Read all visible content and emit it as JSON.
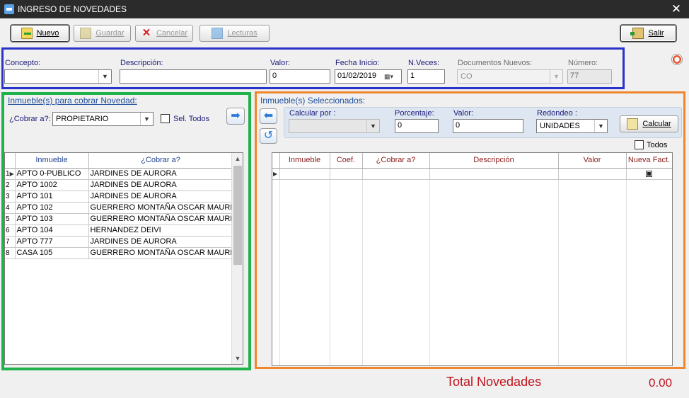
{
  "window": {
    "title": "INGRESO DE NOVEDADES",
    "close_icon": "close-icon"
  },
  "toolbar": {
    "nuevo": "Nuevo",
    "guardar": "Guardar",
    "cancelar": "Cancelar",
    "lecturas": "Lecturas",
    "salir": "Salir"
  },
  "header": {
    "concepto_label": "Concepto:",
    "concepto_value": "",
    "descripcion_label": "Descripción:",
    "descripcion_value": "",
    "valor_label": "Valor:",
    "valor_value": "0",
    "fecha_label": "Fecha Inicio:",
    "fecha_value": "01/02/2019",
    "nveces_label": "N.Veces:",
    "nveces_value": "1",
    "docs_label": "Documentos Nuevos:",
    "docs_value": "CO",
    "numero_label": "Número:",
    "numero_value": "77"
  },
  "left_panel": {
    "title": "Inmueble(s) para cobrar Novedad:",
    "cobrar_label": "¿Cobrar a?:",
    "cobrar_value": "PROPIETARIO",
    "sel_todos": "Sel. Todos",
    "columns": [
      "Inmueble",
      "¿Cobrar a?"
    ],
    "rows": [
      {
        "n": "1",
        "inmueble": "APTO 0-PUBLICO",
        "cobrar": "JARDINES DE AURORA"
      },
      {
        "n": "2",
        "inmueble": "APTO 1002",
        "cobrar": "JARDINES DE AURORA"
      },
      {
        "n": "3",
        "inmueble": "APTO 101",
        "cobrar": "JARDINES DE AURORA"
      },
      {
        "n": "4",
        "inmueble": "APTO 102",
        "cobrar": "GUERRERO MONTAÑA OSCAR MAURI"
      },
      {
        "n": "5",
        "inmueble": "APTO 103",
        "cobrar": "GUERRERO MONTAÑA OSCAR MAURI"
      },
      {
        "n": "6",
        "inmueble": "APTO 104",
        "cobrar": "HERNANDEZ  DEIVI"
      },
      {
        "n": "7",
        "inmueble": "APTO 777",
        "cobrar": "JARDINES DE AURORA"
      },
      {
        "n": "8",
        "inmueble": "CASA 105",
        "cobrar": "GUERRERO MONTAÑA OSCAR MAURI"
      }
    ]
  },
  "right_panel": {
    "title": "Inmueble(s) Seleccionados:",
    "calcular_por_label": "Calcular por :",
    "calcular_por_value": "",
    "porcentaje_label": "Porcentaje:",
    "porcentaje_value": "0",
    "valor_label": "Valor:",
    "valor_value": "0",
    "redondeo_label": "Redondeo :",
    "redondeo_value": "UNIDADES",
    "calcular_button": "Calcular",
    "todos_label": "Todos",
    "columns": [
      "Inmueble",
      "Coef.",
      "¿Cobrar a?",
      "Descripción",
      "Valor",
      "Nueva Fact."
    ]
  },
  "footer": {
    "total_label": "Total Novedades",
    "total_value": "0.00"
  }
}
